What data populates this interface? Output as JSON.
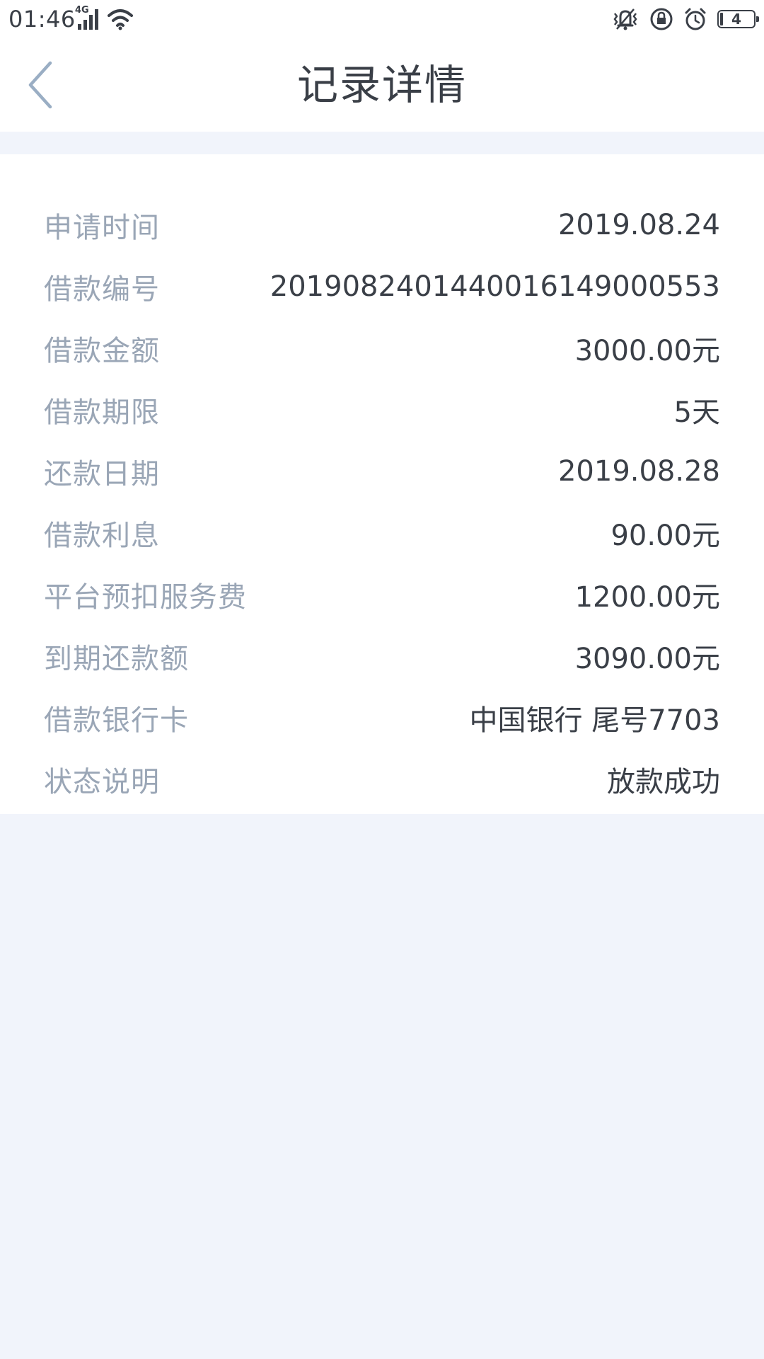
{
  "status_bar": {
    "time": "01:46",
    "network": "4G",
    "battery": "4"
  },
  "header": {
    "title": "记录详情"
  },
  "details": [
    {
      "label": "申请时间",
      "value": "2019.08.24"
    },
    {
      "label": "借款编号",
      "value": "20190824014400161490005​53"
    },
    {
      "label": "借款金额",
      "value": "3000.00元"
    },
    {
      "label": "借款期限",
      "value": "5天"
    },
    {
      "label": "还款日期",
      "value": "2019.08.28"
    },
    {
      "label": "借款利息",
      "value": "90.00元"
    },
    {
      "label": "平台预扣服务费",
      "value": "1200.00元"
    },
    {
      "label": "到期还款额",
      "value": "3090.00元"
    },
    {
      "label": "借款银行卡",
      "value": "中国银行 尾号7703"
    },
    {
      "label": "状态说明",
      "value": "放款成功"
    }
  ],
  "colors": {
    "background": "#f1f4fb",
    "label": "#9aa6b6",
    "value": "#3a3f47",
    "back_arrow": "#9aaec4"
  }
}
